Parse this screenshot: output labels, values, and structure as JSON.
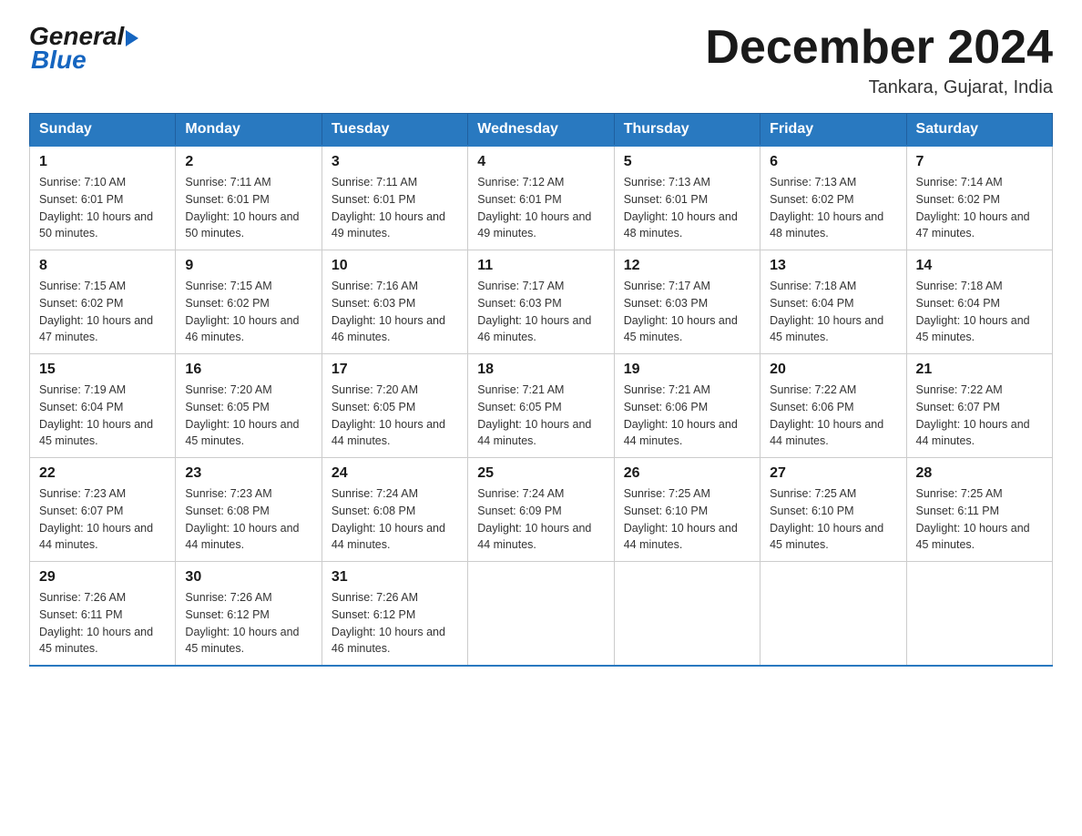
{
  "logo": {
    "general": "General",
    "blue": "Blue"
  },
  "title": "December 2024",
  "location": "Tankara, Gujarat, India",
  "headers": [
    "Sunday",
    "Monday",
    "Tuesday",
    "Wednesday",
    "Thursday",
    "Friday",
    "Saturday"
  ],
  "weeks": [
    [
      {
        "day": "1",
        "sunrise": "7:10 AM",
        "sunset": "6:01 PM",
        "daylight": "10 hours and 50 minutes."
      },
      {
        "day": "2",
        "sunrise": "7:11 AM",
        "sunset": "6:01 PM",
        "daylight": "10 hours and 50 minutes."
      },
      {
        "day": "3",
        "sunrise": "7:11 AM",
        "sunset": "6:01 PM",
        "daylight": "10 hours and 49 minutes."
      },
      {
        "day": "4",
        "sunrise": "7:12 AM",
        "sunset": "6:01 PM",
        "daylight": "10 hours and 49 minutes."
      },
      {
        "day": "5",
        "sunrise": "7:13 AM",
        "sunset": "6:01 PM",
        "daylight": "10 hours and 48 minutes."
      },
      {
        "day": "6",
        "sunrise": "7:13 AM",
        "sunset": "6:02 PM",
        "daylight": "10 hours and 48 minutes."
      },
      {
        "day": "7",
        "sunrise": "7:14 AM",
        "sunset": "6:02 PM",
        "daylight": "10 hours and 47 minutes."
      }
    ],
    [
      {
        "day": "8",
        "sunrise": "7:15 AM",
        "sunset": "6:02 PM",
        "daylight": "10 hours and 47 minutes."
      },
      {
        "day": "9",
        "sunrise": "7:15 AM",
        "sunset": "6:02 PM",
        "daylight": "10 hours and 46 minutes."
      },
      {
        "day": "10",
        "sunrise": "7:16 AM",
        "sunset": "6:03 PM",
        "daylight": "10 hours and 46 minutes."
      },
      {
        "day": "11",
        "sunrise": "7:17 AM",
        "sunset": "6:03 PM",
        "daylight": "10 hours and 46 minutes."
      },
      {
        "day": "12",
        "sunrise": "7:17 AM",
        "sunset": "6:03 PM",
        "daylight": "10 hours and 45 minutes."
      },
      {
        "day": "13",
        "sunrise": "7:18 AM",
        "sunset": "6:04 PM",
        "daylight": "10 hours and 45 minutes."
      },
      {
        "day": "14",
        "sunrise": "7:18 AM",
        "sunset": "6:04 PM",
        "daylight": "10 hours and 45 minutes."
      }
    ],
    [
      {
        "day": "15",
        "sunrise": "7:19 AM",
        "sunset": "6:04 PM",
        "daylight": "10 hours and 45 minutes."
      },
      {
        "day": "16",
        "sunrise": "7:20 AM",
        "sunset": "6:05 PM",
        "daylight": "10 hours and 45 minutes."
      },
      {
        "day": "17",
        "sunrise": "7:20 AM",
        "sunset": "6:05 PM",
        "daylight": "10 hours and 44 minutes."
      },
      {
        "day": "18",
        "sunrise": "7:21 AM",
        "sunset": "6:05 PM",
        "daylight": "10 hours and 44 minutes."
      },
      {
        "day": "19",
        "sunrise": "7:21 AM",
        "sunset": "6:06 PM",
        "daylight": "10 hours and 44 minutes."
      },
      {
        "day": "20",
        "sunrise": "7:22 AM",
        "sunset": "6:06 PM",
        "daylight": "10 hours and 44 minutes."
      },
      {
        "day": "21",
        "sunrise": "7:22 AM",
        "sunset": "6:07 PM",
        "daylight": "10 hours and 44 minutes."
      }
    ],
    [
      {
        "day": "22",
        "sunrise": "7:23 AM",
        "sunset": "6:07 PM",
        "daylight": "10 hours and 44 minutes."
      },
      {
        "day": "23",
        "sunrise": "7:23 AM",
        "sunset": "6:08 PM",
        "daylight": "10 hours and 44 minutes."
      },
      {
        "day": "24",
        "sunrise": "7:24 AM",
        "sunset": "6:08 PM",
        "daylight": "10 hours and 44 minutes."
      },
      {
        "day": "25",
        "sunrise": "7:24 AM",
        "sunset": "6:09 PM",
        "daylight": "10 hours and 44 minutes."
      },
      {
        "day": "26",
        "sunrise": "7:25 AM",
        "sunset": "6:10 PM",
        "daylight": "10 hours and 44 minutes."
      },
      {
        "day": "27",
        "sunrise": "7:25 AM",
        "sunset": "6:10 PM",
        "daylight": "10 hours and 45 minutes."
      },
      {
        "day": "28",
        "sunrise": "7:25 AM",
        "sunset": "6:11 PM",
        "daylight": "10 hours and 45 minutes."
      }
    ],
    [
      {
        "day": "29",
        "sunrise": "7:26 AM",
        "sunset": "6:11 PM",
        "daylight": "10 hours and 45 minutes."
      },
      {
        "day": "30",
        "sunrise": "7:26 AM",
        "sunset": "6:12 PM",
        "daylight": "10 hours and 45 minutes."
      },
      {
        "day": "31",
        "sunrise": "7:26 AM",
        "sunset": "6:12 PM",
        "daylight": "10 hours and 46 minutes."
      },
      null,
      null,
      null,
      null
    ]
  ]
}
